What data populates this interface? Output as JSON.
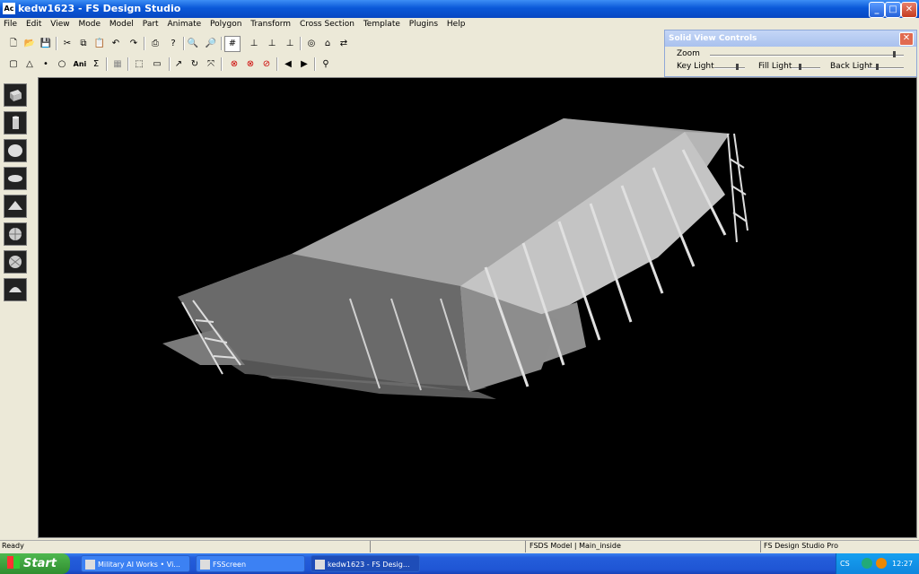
{
  "window": {
    "icon_label": "Ac",
    "title": "kedw1623 - FS Design Studio",
    "btn_min": "_",
    "btn_max": "□",
    "btn_close": "✕"
  },
  "menu": [
    "File",
    "Edit",
    "View",
    "Mode",
    "Model",
    "Part",
    "Animate",
    "Polygon",
    "Transform",
    "Cross Section",
    "Template",
    "Plugins",
    "Help"
  ],
  "toolbar1": [
    "new-icon",
    "open-icon",
    "save-icon",
    "cut-icon",
    "copy-icon",
    "paste-icon",
    "undo-icon",
    "redo-icon",
    "print-icon",
    "help-icon",
    "zoom-in-icon",
    "zoom-out-icon",
    "grid-icon",
    "align-x-icon",
    "align-y-icon",
    "align-z-icon",
    "view3d-icon",
    "home-icon",
    "export-icon"
  ],
  "toolbar2": {
    "ani_label": "Ani",
    "sum_label": "Σ"
  },
  "solid_view_controls": {
    "title": "Solid View Controls",
    "zoom_label": "Zoom",
    "key_light_label": "Key Light",
    "fill_light_label": "Fill Light",
    "back_light_label": "Back Light",
    "zoom_value": 0.95,
    "key_light_value": 0.7,
    "fill_light_value": 0.3,
    "back_light_value": 0.25
  },
  "left_tools": [
    "box-icon",
    "cylinder-icon",
    "sphere-icon",
    "disc-icon",
    "pyramid-icon",
    "globe-icon",
    "geosphere-icon",
    "dome-icon"
  ],
  "status": {
    "left": "Ready",
    "model": "FSDS Model | Main_inside",
    "product": "FS Design Studio Pro"
  },
  "taskbar": {
    "start_label": "Start",
    "tasks": [
      "Military AI Works • Vi...",
      "FSScreen",
      "kedw1623 - FS Desig..."
    ],
    "lang": "CS",
    "clock": "12:27"
  },
  "colors": {
    "viewport_bg": "#000000",
    "model_light": "#b8b8b8",
    "model_dark": "#5e5e5e"
  }
}
